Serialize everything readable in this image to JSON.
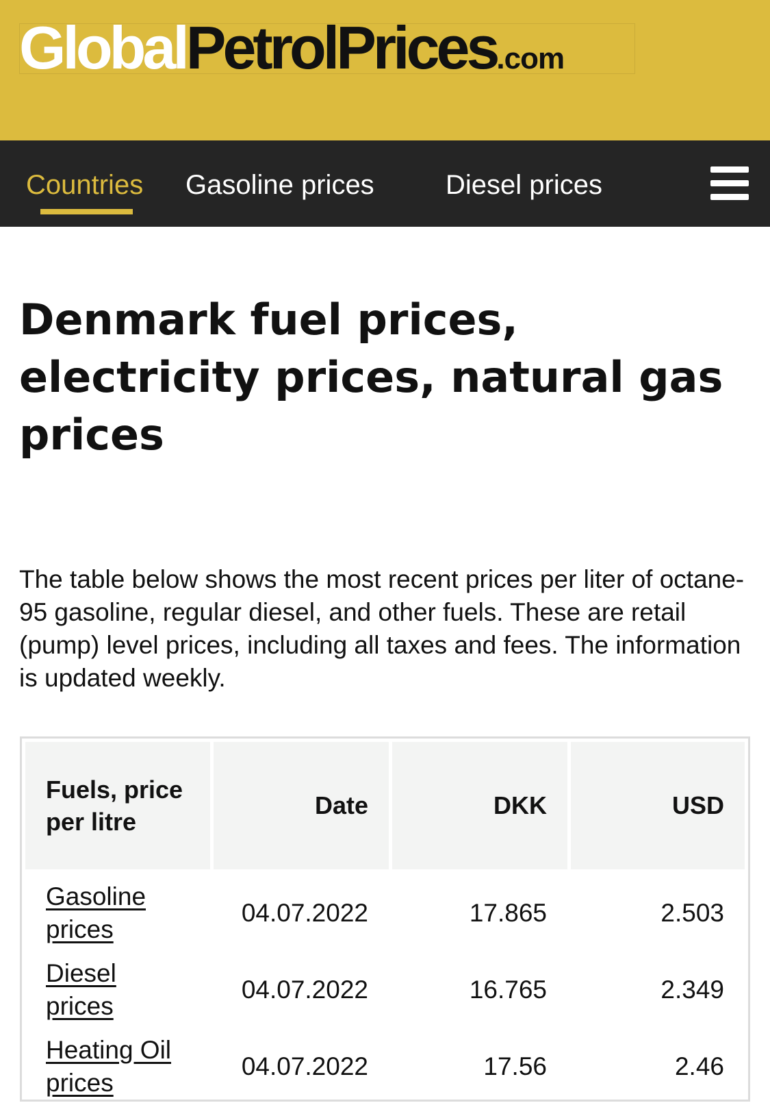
{
  "brand": {
    "logo_part1": "Global",
    "logo_part2": "PetrolPrices",
    "logo_part3": ".com",
    "colors": {
      "header_bg": "#dcbb3e",
      "nav_bg": "#252525",
      "accent": "#dcbb3e"
    }
  },
  "nav": {
    "items": [
      {
        "label": "Countries",
        "active": true
      },
      {
        "label": "Gasoline prices",
        "active": false
      },
      {
        "label": "Diesel prices",
        "active": false
      }
    ],
    "menu_icon": "hamburger-menu-icon"
  },
  "page": {
    "title": "Denmark fuel prices, electricity prices, natural gas prices",
    "intro": "The table below shows the most recent prices per liter of octane-95 gasoline, regular diesel, and other fuels. These are retail (pump) level prices, including all taxes and fees. The information is updated weekly."
  },
  "table": {
    "headers": [
      "Fuels, price per litre",
      "Date",
      "DKK",
      "USD"
    ],
    "rows": [
      {
        "fuel": "Gasoline prices",
        "date": "04.07.2022",
        "dkk": "17.865",
        "usd": "2.503"
      },
      {
        "fuel": "Diesel prices",
        "date": "04.07.2022",
        "dkk": "16.765",
        "usd": "2.349"
      },
      {
        "fuel": "Heating Oil prices",
        "date": "04.07.2022",
        "dkk": "17.56",
        "usd": "2.46"
      }
    ]
  }
}
